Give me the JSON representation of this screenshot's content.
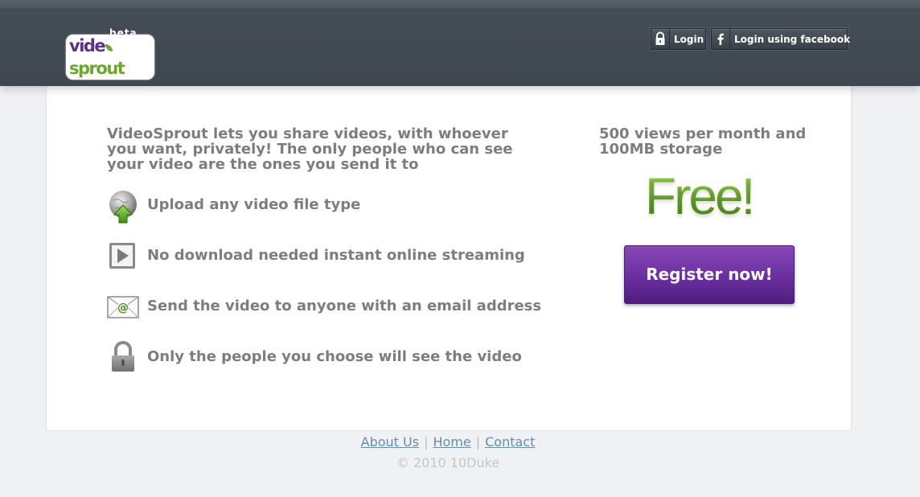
{
  "header": {
    "logo": {
      "part1": "vide",
      "part2": "sprout",
      "badge": "beta"
    },
    "login_label": "Login",
    "facebook_login_label": "Login using facebook"
  },
  "main": {
    "intro": "VideoSprout lets you share videos, with whoever you want, privately! The only people who can see your video are the ones you send it to",
    "features": [
      {
        "icon": "globe-upload-icon",
        "text": "Upload any video file type"
      },
      {
        "icon": "play-icon",
        "text": "No download needed instant online streaming"
      },
      {
        "icon": "email-icon",
        "text": "Send the video to anyone with an email address"
      },
      {
        "icon": "padlock-icon",
        "text": "Only the people you choose will see the video"
      }
    ],
    "offer": "500 views per month and 100MB storage",
    "free_label": "Free!",
    "register_label": "Register now!"
  },
  "footer": {
    "links": [
      "About Us",
      "Home",
      "Contact"
    ],
    "separator": "|",
    "copyright": "© 2010 10Duke"
  },
  "colors": {
    "header_bg": "#3e474f",
    "brand_purple": "#5f2d8e",
    "brand_green": "#6ba72c",
    "text_gray": "#7d7d7d",
    "link_blue": "#6a8ca6"
  }
}
